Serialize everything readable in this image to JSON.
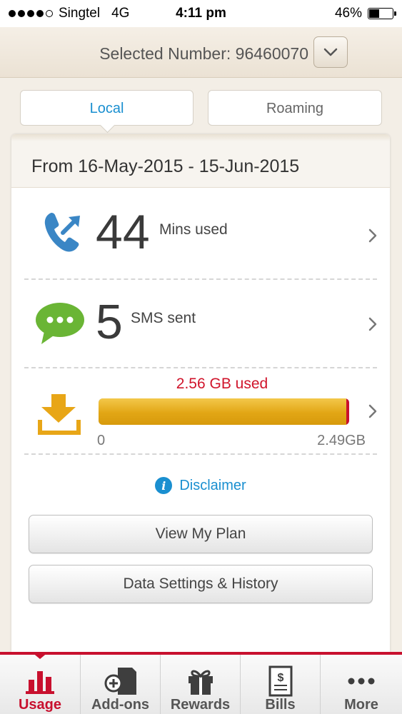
{
  "status_bar": {
    "carrier": "Singtel",
    "network": "4G",
    "time": "4:11 pm",
    "battery": "46%",
    "battery_level": 0.46
  },
  "header": {
    "selected_number": "Selected Number: 96460070"
  },
  "tabs": [
    {
      "label": "Local",
      "active": true
    },
    {
      "label": "Roaming",
      "active": false
    }
  ],
  "period": "From 16-May-2015 - 15-Jun-2015",
  "usage": {
    "calls": {
      "value": "44",
      "label": "Mins used",
      "icon": "phone-icon"
    },
    "sms": {
      "value": "5",
      "label": "SMS sent",
      "icon": "chat-bubble-icon"
    },
    "data": {
      "used_text": "2.56 GB used",
      "min_label": "0",
      "max_label": "2.49GB",
      "fill_fraction": 1.0,
      "icon": "download-icon"
    }
  },
  "disclaimer": "Disclaimer",
  "buttons": {
    "view_plan": "View My Plan",
    "data_settings": "Data Settings & History"
  },
  "tabbar": [
    {
      "label": "Usage",
      "icon": "bar-chart-icon",
      "active": true
    },
    {
      "label": "Add-ons",
      "icon": "add-sim-icon",
      "active": false
    },
    {
      "label": "Rewards",
      "icon": "gift-icon",
      "active": false
    },
    {
      "label": "Bills",
      "icon": "bill-icon",
      "active": false
    },
    {
      "label": "More",
      "icon": "more-icon",
      "active": false
    }
  ],
  "colors": {
    "accent_blue": "#1a8fd0",
    "brand_red": "#c8102e",
    "data_bar": "#e2a615",
    "sms_green": "#6ab535"
  }
}
